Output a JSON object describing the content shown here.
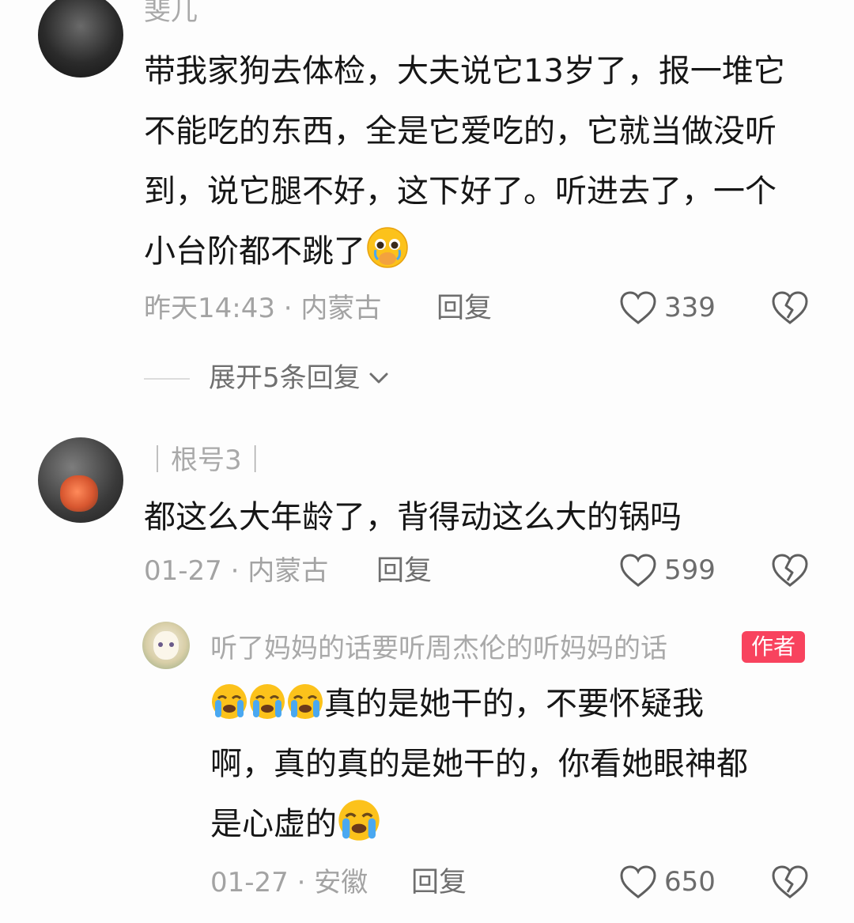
{
  "comments": [
    {
      "username": "斐儿",
      "text": "带我家狗去体检，大夫说它13岁了，报一堆它不能吃的东西，全是它爱吃的，它就当做没听到，说它腿不好，这下好了。听进去了，一个小台阶都不跳了",
      "emoji": "pleading-face-icon",
      "time_location": "昨天14:43 · 内蒙古",
      "reply_label": "回复",
      "likes": "339",
      "expand_label": "展开5条回复"
    },
    {
      "username": "｜根号3｜",
      "text": "都这么大年龄了，背得动这么大的锅吗",
      "time_location": "01-27 · 内蒙古",
      "reply_label": "回复",
      "likes": "599"
    },
    {
      "username": "听了妈妈的话要听周杰伦的听妈妈的话",
      "badge": "作者",
      "text_part1": "真的是她干的，不要怀疑我",
      "text_part2": "啊，真的真的是她干的，你看她眼神都",
      "text_part3": "是心虚的",
      "time_location": "01-27 · 安徽",
      "reply_label": "回复",
      "likes": "650"
    }
  ],
  "colors": {
    "author_badge": "#f8435e",
    "secondary_text": "#a3a3a3",
    "primary_text": "#161616"
  }
}
